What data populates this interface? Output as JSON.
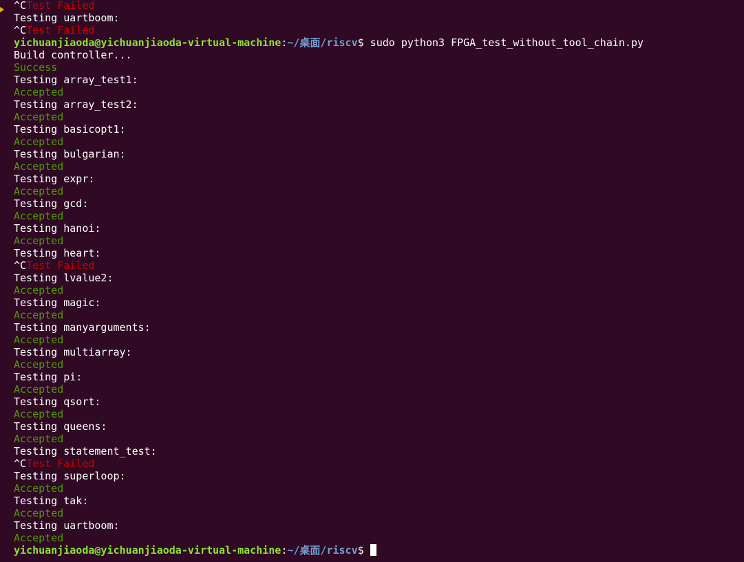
{
  "prompt": {
    "user_host": "yichuanjiaoda@yichuanjiaoda-virtual-machine",
    "colon": ":",
    "path": "~/桌面/riscv",
    "dollar": "$ "
  },
  "lines": [
    {
      "kind": "fail_ctrlc",
      "prefix": "^C",
      "text": "Test Failed"
    },
    {
      "kind": "plain",
      "text": "Testing uartboom:"
    },
    {
      "kind": "fail_ctrlc",
      "prefix": "^C",
      "text": "Test Failed"
    },
    {
      "kind": "prompt",
      "command": "sudo python3 FPGA_test_without_tool_chain.py"
    },
    {
      "kind": "plain",
      "text": "Build controller..."
    },
    {
      "kind": "ok",
      "text": "Success"
    },
    {
      "kind": "plain",
      "text": "Testing array_test1:"
    },
    {
      "kind": "ok",
      "text": "Accepted"
    },
    {
      "kind": "plain",
      "text": "Testing array_test2:"
    },
    {
      "kind": "ok",
      "text": "Accepted"
    },
    {
      "kind": "plain",
      "text": "Testing basicopt1:"
    },
    {
      "kind": "ok",
      "text": "Accepted"
    },
    {
      "kind": "plain",
      "text": "Testing bulgarian:"
    },
    {
      "kind": "ok",
      "text": "Accepted"
    },
    {
      "kind": "plain",
      "text": "Testing expr:"
    },
    {
      "kind": "ok",
      "text": "Accepted"
    },
    {
      "kind": "plain",
      "text": "Testing gcd:"
    },
    {
      "kind": "ok",
      "text": "Accepted"
    },
    {
      "kind": "plain",
      "text": "Testing hanoi:"
    },
    {
      "kind": "ok",
      "text": "Accepted"
    },
    {
      "kind": "plain",
      "text": "Testing heart:"
    },
    {
      "kind": "fail_ctrlc",
      "prefix": "^C",
      "text": "Test Failed"
    },
    {
      "kind": "plain",
      "text": "Testing lvalue2:"
    },
    {
      "kind": "ok",
      "text": "Accepted"
    },
    {
      "kind": "plain",
      "text": "Testing magic:"
    },
    {
      "kind": "ok",
      "text": "Accepted"
    },
    {
      "kind": "plain",
      "text": "Testing manyarguments:"
    },
    {
      "kind": "ok",
      "text": "Accepted"
    },
    {
      "kind": "plain",
      "text": "Testing multiarray:"
    },
    {
      "kind": "ok",
      "text": "Accepted"
    },
    {
      "kind": "plain",
      "text": "Testing pi:"
    },
    {
      "kind": "ok",
      "text": "Accepted"
    },
    {
      "kind": "plain",
      "text": "Testing qsort:"
    },
    {
      "kind": "ok",
      "text": "Accepted"
    },
    {
      "kind": "plain",
      "text": "Testing queens:"
    },
    {
      "kind": "ok",
      "text": "Accepted"
    },
    {
      "kind": "plain",
      "text": "Testing statement_test:"
    },
    {
      "kind": "fail_ctrlc",
      "prefix": "^C",
      "text": "Test Failed"
    },
    {
      "kind": "plain",
      "text": "Testing superloop:"
    },
    {
      "kind": "ok",
      "text": "Accepted"
    },
    {
      "kind": "plain",
      "text": "Testing tak:"
    },
    {
      "kind": "ok",
      "text": "Accepted"
    },
    {
      "kind": "plain",
      "text": "Testing uartboom:"
    },
    {
      "kind": "ok",
      "text": "Accepted"
    },
    {
      "kind": "prompt_cursor",
      "command": ""
    }
  ],
  "colors": {
    "background": "#300a24",
    "text": "#ffffff",
    "fail": "#cc0000",
    "success": "#4e9a06",
    "user_host": "#8ae234",
    "path": "#729fcf",
    "marker": "#e9ad0c"
  }
}
